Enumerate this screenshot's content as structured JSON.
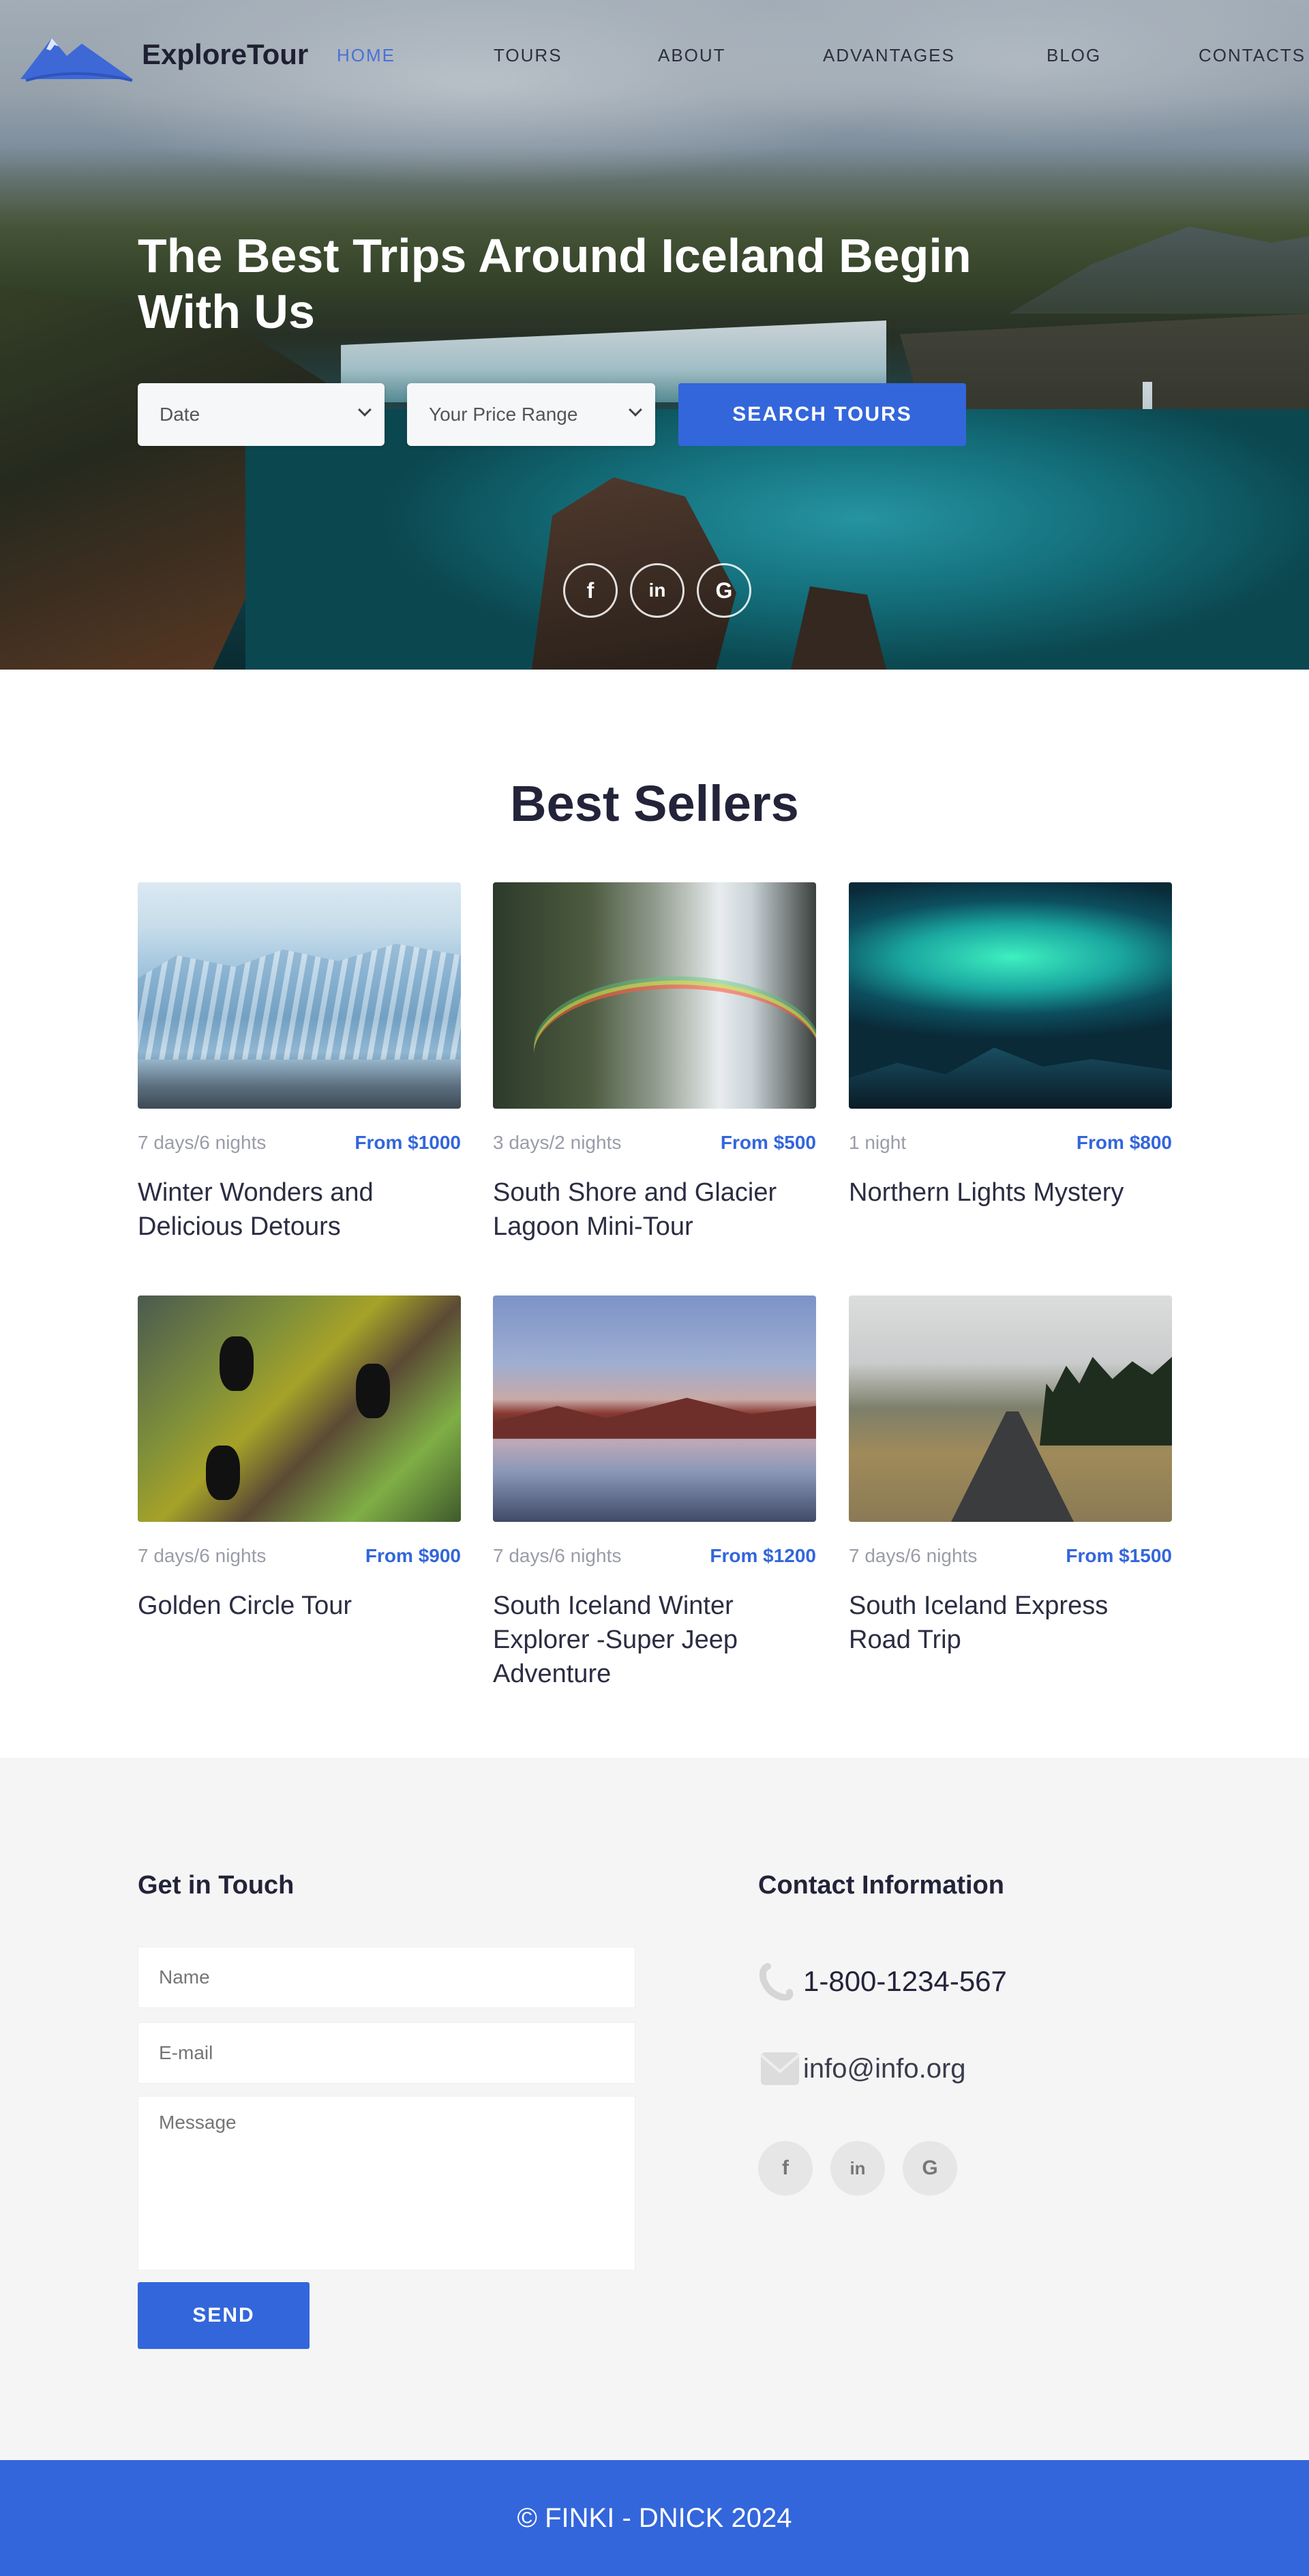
{
  "brand": {
    "name": "ExploreTour"
  },
  "nav": {
    "items": [
      {
        "label": "HOME",
        "active": true
      },
      {
        "label": "TOURS"
      },
      {
        "label": "ABOUT"
      },
      {
        "label": "ADVANTAGES"
      },
      {
        "label": "BLOG"
      },
      {
        "label": "CONTACTS"
      }
    ]
  },
  "hero": {
    "headline": "The Best Trips Around Iceland Begin With Us",
    "date_select": {
      "selected": "Date"
    },
    "price_select": {
      "selected": "Your Price Range"
    },
    "search_label": "SEARCH TOURS",
    "social": [
      {
        "icon": "facebook-icon",
        "glyph": "f"
      },
      {
        "icon": "linkedin-icon",
        "glyph": "in"
      },
      {
        "icon": "google-icon",
        "glyph": "G"
      }
    ]
  },
  "best_sellers": {
    "title": "Best Sellers",
    "tours": [
      {
        "duration": "7 days/6 nights",
        "price": "From $1000",
        "name": "Winter Wonders and Delicious Detours"
      },
      {
        "duration": "3 days/2 nights",
        "price": "From $500",
        "name": "South Shore and Glacier Lagoon Mini-Tour"
      },
      {
        "duration": "1 night",
        "price": "From $800",
        "name": "Northern Lights Mystery"
      },
      {
        "duration": "7 days/6 nights",
        "price": "From $900",
        "name": "Golden Circle Tour"
      },
      {
        "duration": "7 days/6 nights",
        "price": "From $1200",
        "name": "South Iceland Winter Explorer -Super Jeep Adventure"
      },
      {
        "duration": "7 days/6 nights",
        "price": "From $1500",
        "name": "South Iceland Express Road Trip"
      }
    ]
  },
  "contact": {
    "form_title": "Get in Touch",
    "name_placeholder": "Name",
    "email_placeholder": "E-mail",
    "message_placeholder": "Message",
    "send_label": "SEND",
    "info_title": "Contact Information",
    "phone": "1-800-1234-567",
    "email": "info@info.org",
    "social": [
      {
        "icon": "facebook-icon",
        "glyph": "f"
      },
      {
        "icon": "linkedin-icon",
        "glyph": "in"
      },
      {
        "icon": "google-icon",
        "glyph": "G"
      }
    ]
  },
  "footer": {
    "text": "© FINKI - DNICK 2024"
  },
  "colors": {
    "accent": "#3366db",
    "nav_active": "#4a70d8",
    "footer_bg": "#3366db",
    "contact_bg": "#f5f5f5"
  }
}
